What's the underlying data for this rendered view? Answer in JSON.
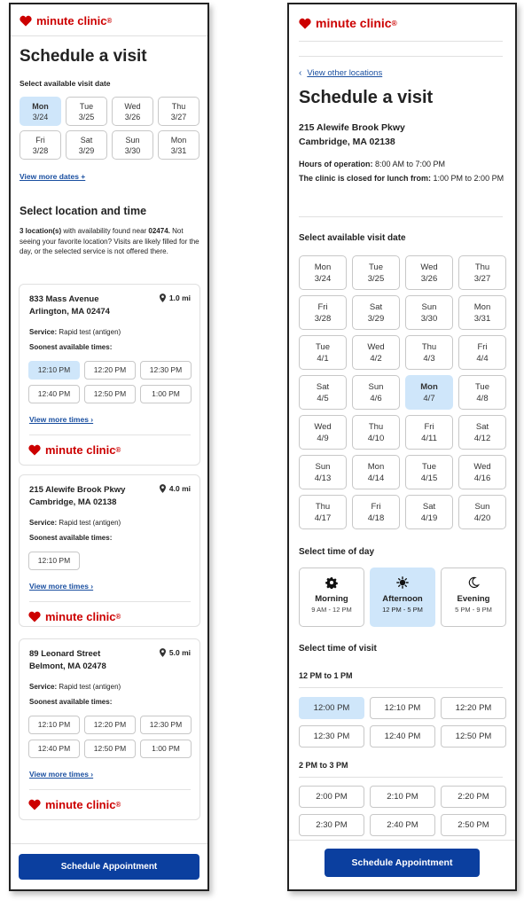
{
  "brand": {
    "name": "minute clinic",
    "reg": "®",
    "color": "#cc0000",
    "accent": "#0b3f9f",
    "selected_bg": "#cfe6fa"
  },
  "left": {
    "title": "Schedule a visit",
    "date_label": "Select available visit date",
    "dates": [
      {
        "day": "Mon",
        "date": "3/24",
        "selected": true
      },
      {
        "day": "Tue",
        "date": "3/25"
      },
      {
        "day": "Wed",
        "date": "3/26"
      },
      {
        "day": "Thu",
        "date": "3/27"
      },
      {
        "day": "Fri",
        "date": "3/28"
      },
      {
        "day": "Sat",
        "date": "3/29"
      },
      {
        "day": "Sun",
        "date": "3/30"
      },
      {
        "day": "Mon",
        "date": "3/31"
      }
    ],
    "more_dates": "View more dates +",
    "section_title": "Select location and time",
    "intro": {
      "count": "3 location(s)",
      "near_text": " with availability found near ",
      "zip": "02474.",
      "rest": " Not seeing your favorite location? Visits are likely filled for the day, or the selected service is not offered there."
    },
    "locations": [
      {
        "street": "833 Mass Avenue",
        "city": "Arlington, MA 02474",
        "distance": "1.0 mi",
        "service_label": "Service:",
        "service": " Rapid test (antigen)",
        "soonest": "Soonest available times:",
        "times": [
          "12:10 PM",
          "12:20 PM",
          "12:30 PM",
          "12:40 PM",
          "12:50 PM",
          "1:00 PM"
        ],
        "more_times": "View more times ›"
      },
      {
        "street": "215 Alewife Brook Pkwy",
        "city": "Cambridge, MA 02138",
        "distance": "4.0 mi",
        "service_label": "Service:",
        "service": " Rapid test (antigen)",
        "soonest": "Soonest available times:",
        "times": [
          "12:10 PM"
        ],
        "more_times": "View more times ›"
      },
      {
        "street": "89 Leonard Street",
        "city": "Belmont, MA 02478",
        "distance": "5.0 mi",
        "service_label": "Service:",
        "service": " Rapid test (antigen)",
        "soonest": "Soonest available times:",
        "times": [
          "12:10 PM",
          "12:20 PM",
          "12:30 PM",
          "12:40 PM",
          "12:50 PM",
          "1:00 PM"
        ],
        "more_times": "View more times ›"
      }
    ],
    "cta": "Schedule Appointment"
  },
  "right": {
    "back_link": "View other locations",
    "title": "Schedule a visit",
    "address_line1": "215 Alewife Brook Pkwy",
    "address_line2": "Cambridge, MA 02138",
    "hours_label": "Hours of operation:",
    "hours_value": " 8:00 AM to 7:00 PM",
    "lunch_label": "The clinic is closed for lunch from:",
    "lunch_value": " 1:00 PM to 2:00 PM",
    "date_label": "Select available visit date",
    "dates": [
      {
        "day": "Mon",
        "date": "3/24"
      },
      {
        "day": "Tue",
        "date": "3/25"
      },
      {
        "day": "Wed",
        "date": "3/26"
      },
      {
        "day": "Thu",
        "date": "3/27"
      },
      {
        "day": "Fri",
        "date": "3/28"
      },
      {
        "day": "Sat",
        "date": "3/29"
      },
      {
        "day": "Sun",
        "date": "3/30"
      },
      {
        "day": "Mon",
        "date": "3/31"
      },
      {
        "day": "Tue",
        "date": "4/1"
      },
      {
        "day": "Wed",
        "date": "4/2"
      },
      {
        "day": "Thu",
        "date": "4/3"
      },
      {
        "day": "Fri",
        "date": "4/4"
      },
      {
        "day": "Sat",
        "date": "4/5"
      },
      {
        "day": "Sun",
        "date": "4/6"
      },
      {
        "day": "Mon",
        "date": "4/7",
        "selected": true
      },
      {
        "day": "Tue",
        "date": "4/8"
      },
      {
        "day": "Wed",
        "date": "4/9"
      },
      {
        "day": "Thu",
        "date": "4/10"
      },
      {
        "day": "Fri",
        "date": "4/11"
      },
      {
        "day": "Sat",
        "date": "4/12"
      },
      {
        "day": "Sun",
        "date": "4/13"
      },
      {
        "day": "Mon",
        "date": "4/14"
      },
      {
        "day": "Tue",
        "date": "4/15"
      },
      {
        "day": "Wed",
        "date": "4/16"
      },
      {
        "day": "Thu",
        "date": "4/17"
      },
      {
        "day": "Fri",
        "date": "4/18"
      },
      {
        "day": "Sat",
        "date": "4/19"
      },
      {
        "day": "Sun",
        "date": "4/20"
      }
    ],
    "tod_label": "Select time of day",
    "times_of_day": [
      {
        "icon": "gear-icon",
        "name": "Morning",
        "range": "9 AM - 12 PM"
      },
      {
        "icon": "sun-icon",
        "name": "Afternoon",
        "range": "12 PM - 5 PM",
        "selected": true
      },
      {
        "icon": "moon-icon",
        "name": "Evening",
        "range": "5 PM - 9 PM"
      }
    ],
    "tov_label": "Select time of visit",
    "slot_groups": [
      {
        "heading": "12 PM to 1 PM",
        "times": [
          "12:00 PM",
          "12:10 PM",
          "12:20 PM",
          "12:30 PM",
          "12:40 PM",
          "12:50 PM"
        ],
        "selected": "12:00 PM"
      },
      {
        "heading": "2 PM to 3 PM",
        "times": [
          "2:00 PM",
          "2:10 PM",
          "2:20 PM",
          "2:30 PM",
          "2:40 PM",
          "2:50 PM"
        ]
      }
    ],
    "cta": "Schedule Appointment"
  }
}
